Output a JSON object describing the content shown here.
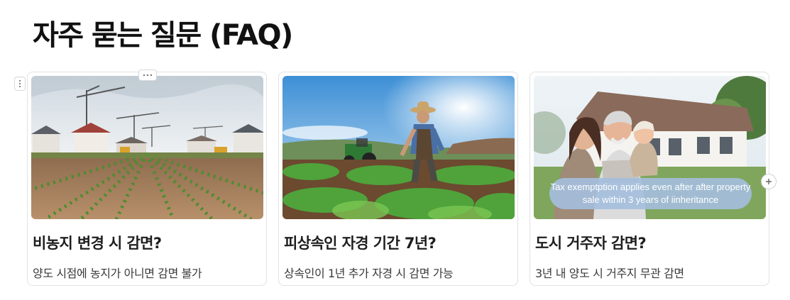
{
  "page": {
    "title": "자주 묻는 질문 (FAQ)"
  },
  "controls": {
    "block_handle_icon": "drag-handle-icon",
    "more_icon": "more-horizontal-icon",
    "add_icon": "plus-icon"
  },
  "cards": [
    {
      "title": "비농지 변경 시 감면?",
      "description": "양도 시점에 농지가 아니면 감면 불가",
      "image": "farmland-with-construction-cranes"
    },
    {
      "title": "피상속인 자경 기간 7년?",
      "description": "상속인이 1년 추가 자경 시 감면 가능",
      "image": "farmer-tending-crops-with-tractor"
    },
    {
      "title": "도시 거주자 감면?",
      "description": "3년 내 양도 시 거주지 무관 감면",
      "image": "family-in-front-of-country-house",
      "overlay_text": "Tax exemptption applies even after after property sale within 3 years of iinheritance"
    }
  ]
}
